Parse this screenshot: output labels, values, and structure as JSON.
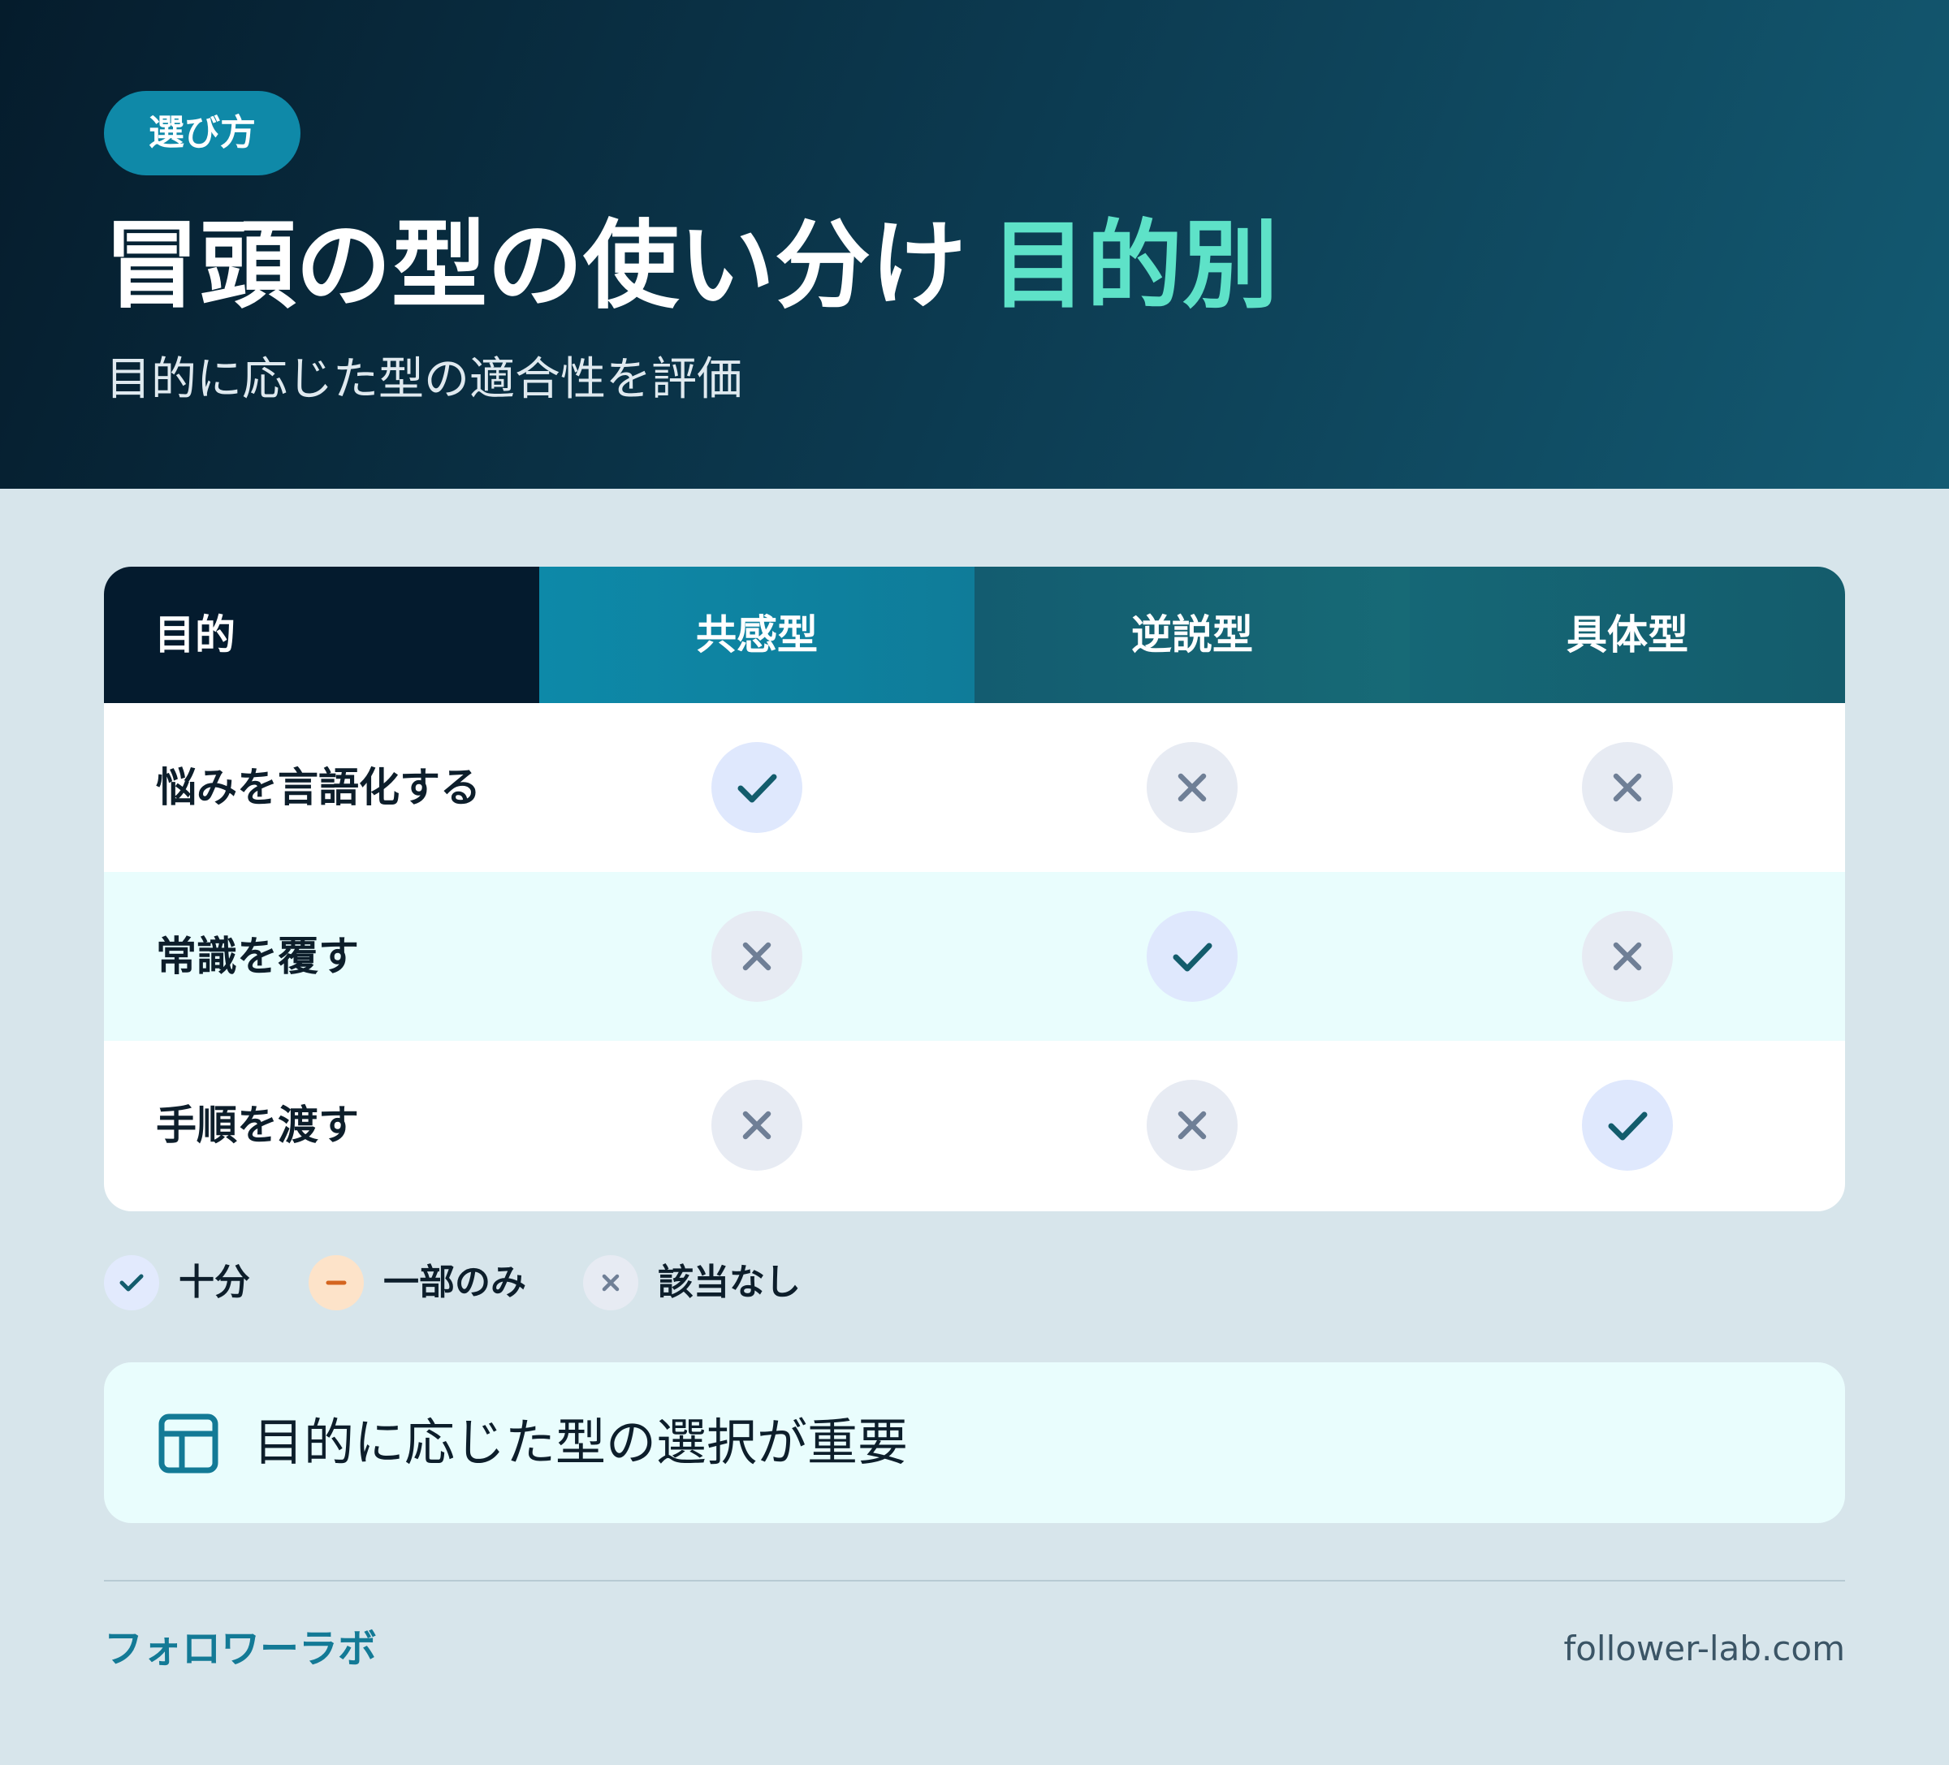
{
  "header": {
    "badge": "選び方",
    "title_main": "冒頭の型の使い分け",
    "title_accent": "目的別",
    "subtitle": "目的に応じた型の適合性を評価"
  },
  "table": {
    "columns": [
      "目的",
      "共感型",
      "逆説型",
      "具体型"
    ],
    "rows": [
      {
        "label": "悩みを言語化する",
        "values": [
          "check",
          "cross",
          "cross"
        ]
      },
      {
        "label": "常識を覆す",
        "values": [
          "cross",
          "check",
          "cross"
        ]
      },
      {
        "label": "手順を渡す",
        "values": [
          "cross",
          "cross",
          "check"
        ]
      }
    ]
  },
  "legend": [
    {
      "icon": "check-icon",
      "label": "十分"
    },
    {
      "icon": "minus-icon",
      "label": "一部のみ"
    },
    {
      "icon": "cross-icon",
      "label": "該当なし"
    }
  ],
  "note": {
    "icon": "layout-icon",
    "text": "目的に応じた型の選択が重要"
  },
  "footer": {
    "brand": "フォロワーラボ",
    "domain": "follower-lab.com"
  },
  "colors": {
    "accent": "#5ee2c8",
    "check": "#135c6c",
    "cross": "#6f7f96",
    "partial": "#d4651f",
    "brand": "#137a96"
  }
}
